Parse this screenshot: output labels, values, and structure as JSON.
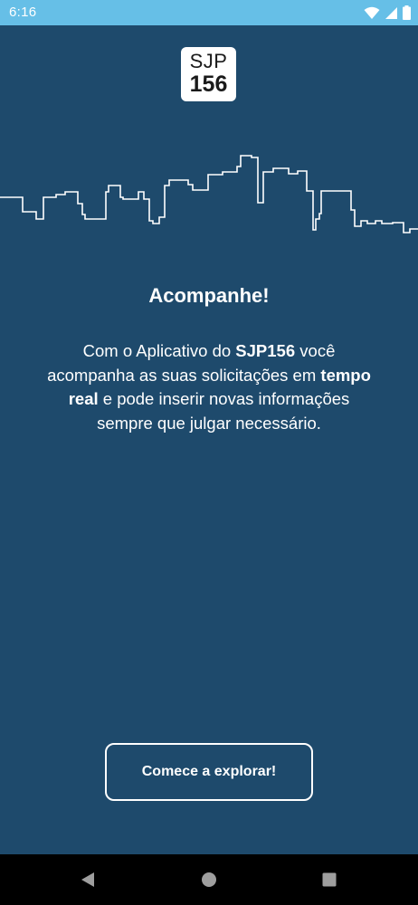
{
  "status_bar": {
    "time": "6:16",
    "background_color": "#66bfe7",
    "icons": [
      "wifi-icon",
      "signal-icon",
      "battery-icon"
    ]
  },
  "logo": {
    "line1": "SJP",
    "line2": "156"
  },
  "skyline": {
    "icon": "city-skyline-outline"
  },
  "onboarding": {
    "title": "Acompanhe!",
    "description": {
      "part1": "Com o Aplicativo do ",
      "bold1": "SJP156",
      "part2": " você acompanha as suas solicitações em ",
      "bold2": "tempo real",
      "part3": " e pode inserir novas informações sempre que julgar necessário."
    },
    "cta_label": "Comece a explorar!"
  },
  "theme": {
    "background_color": "#1e4a6c",
    "text_color": "#ffffff"
  },
  "nav_bar": {
    "icons": [
      "back-icon",
      "home-icon",
      "recents-icon"
    ]
  }
}
